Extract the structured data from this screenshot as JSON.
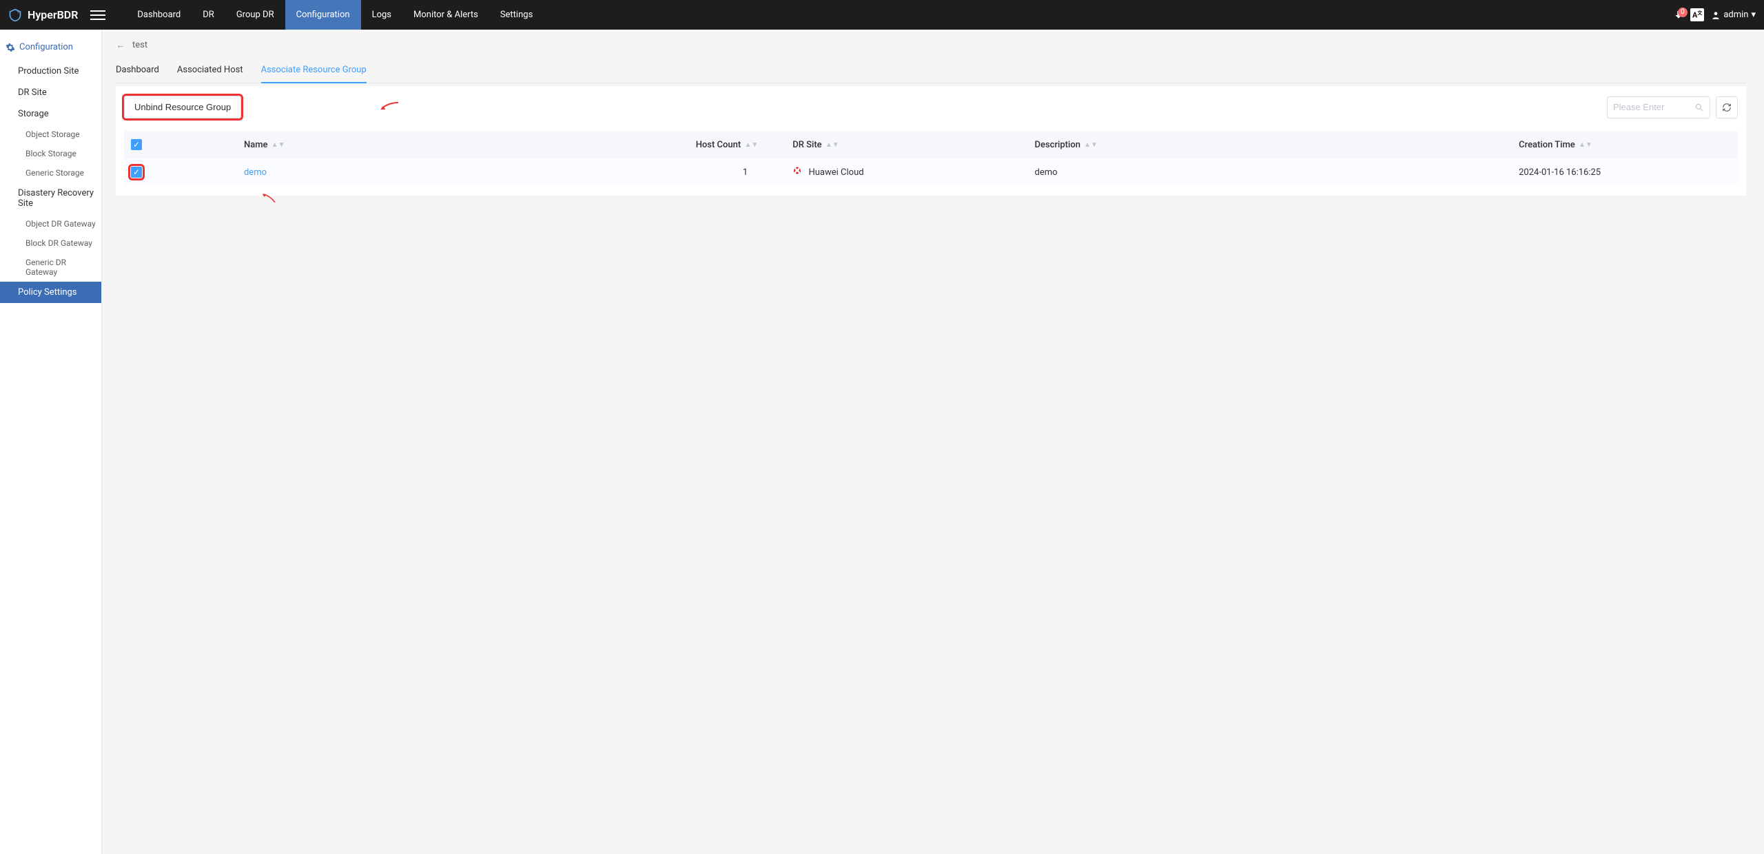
{
  "brand": "HyperBDR",
  "topnav": {
    "items": [
      "Dashboard",
      "DR",
      "Group DR",
      "Configuration",
      "Logs",
      "Monitor & Alerts",
      "Settings"
    ],
    "active_index": 3,
    "notification_count": "0",
    "locale_badge": "A",
    "user": "admin"
  },
  "sidebar": {
    "header": "Configuration",
    "sections": [
      {
        "label": "Production Site",
        "subs": []
      },
      {
        "label": "DR Site",
        "subs": []
      },
      {
        "label": "Storage",
        "subs": [
          "Object Storage",
          "Block Storage",
          "Generic Storage"
        ]
      },
      {
        "label": "Disastery Recovery Site",
        "subs": [
          "Object DR Gateway",
          "Block DR Gateway",
          "Generic DR Gateway"
        ]
      },
      {
        "label": "Policy Settings",
        "subs": [],
        "active": true
      }
    ]
  },
  "breadcrumb": {
    "title": "test"
  },
  "tabs": {
    "items": [
      "Dashboard",
      "Associated Host",
      "Associate Resource Group"
    ],
    "active_index": 2
  },
  "toolbar": {
    "unbind_label": "Unbind Resource Group",
    "search_placeholder": "Please Enter"
  },
  "table": {
    "headers": {
      "name": "Name",
      "host_count": "Host Count",
      "dr_site": "DR Site",
      "description": "Description",
      "creation_time": "Creation Time"
    },
    "rows": [
      {
        "name": "demo",
        "host_count": "1",
        "dr_site": "Huawei Cloud",
        "description": "demo",
        "creation_time": "2024-01-16 16:16:25",
        "checked": true
      }
    ]
  }
}
